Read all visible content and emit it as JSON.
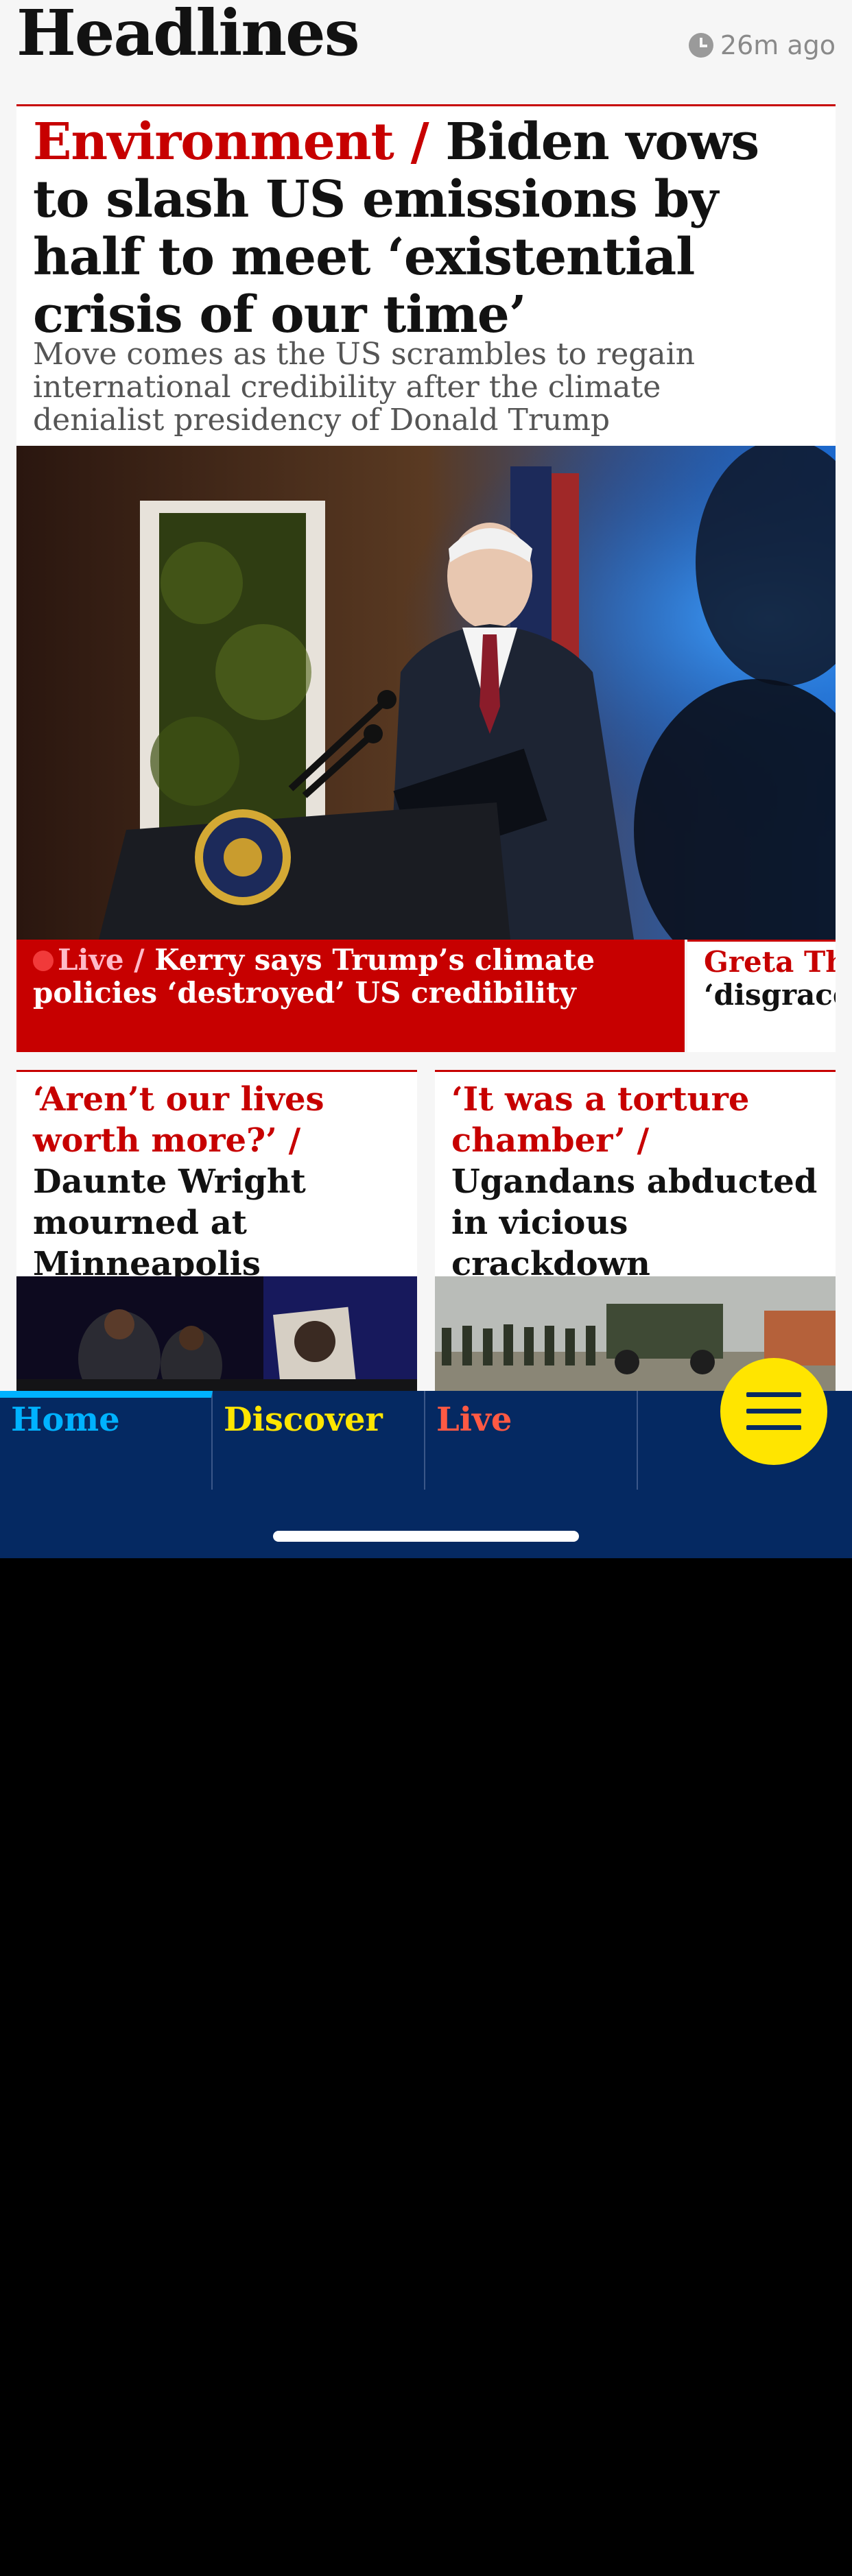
{
  "section": {
    "title": "Headlines",
    "updated": "26m ago"
  },
  "lead": {
    "kicker": "Environment /",
    "headline": "Biden vows to slash US emissions by half to meet ‘existential crisis of our time’",
    "standfirst": "Move comes as the US scrambles to regain international credibility after the climate denialist presidency of Donald Trump",
    "image_alt": "Joe Biden speaking at a podium"
  },
  "sublinks": [
    {
      "kicker": "Live /",
      "text": "Kerry says Trump’s climate policies ‘destroyed’ US credibility"
    },
    {
      "kicker": "Greta Thu",
      "text": "‘disgrace’,"
    }
  ],
  "cards": [
    {
      "kicker": "‘Aren’t our lives worth more?’ /",
      "headline": "Daunte Wright mourned at Minneapolis funeral"
    },
    {
      "kicker": "‘It was a torture chamber’ /",
      "headline": "Ugandans abducted in vicious crackdown"
    }
  ],
  "tabs": [
    {
      "label": "Home",
      "color": "#00b2ff"
    },
    {
      "label": "Discover",
      "color": "#ffe500"
    },
    {
      "label": "Live",
      "color": "#ff5943"
    }
  ],
  "colors": {
    "navy": "#052962",
    "news_red": "#c70000",
    "menu_yellow": "#ffe500"
  },
  "icons": {
    "updated": "clock-icon",
    "menu": "hamburger-menu-icon"
  }
}
